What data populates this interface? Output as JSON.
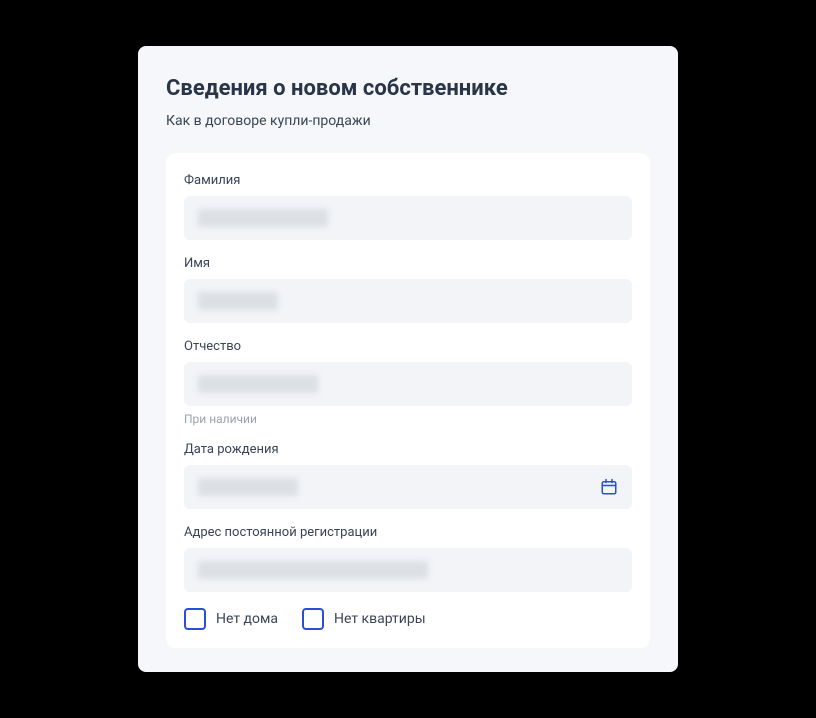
{
  "header": {
    "title": "Сведения о новом собственнике",
    "subtitle": "Как в договоре купли-продажи"
  },
  "fields": {
    "surname": {
      "label": "Фамилия"
    },
    "name": {
      "label": "Имя"
    },
    "patronymic": {
      "label": "Отчество",
      "hint": "При наличии"
    },
    "birthdate": {
      "label": "Дата рождения"
    },
    "address": {
      "label": "Адрес постоянной регистрации"
    }
  },
  "checkboxes": {
    "no_house": {
      "label": "Нет дома"
    },
    "no_apartment": {
      "label": "Нет квартиры"
    }
  },
  "colors": {
    "accent": "#2b4ed4"
  }
}
